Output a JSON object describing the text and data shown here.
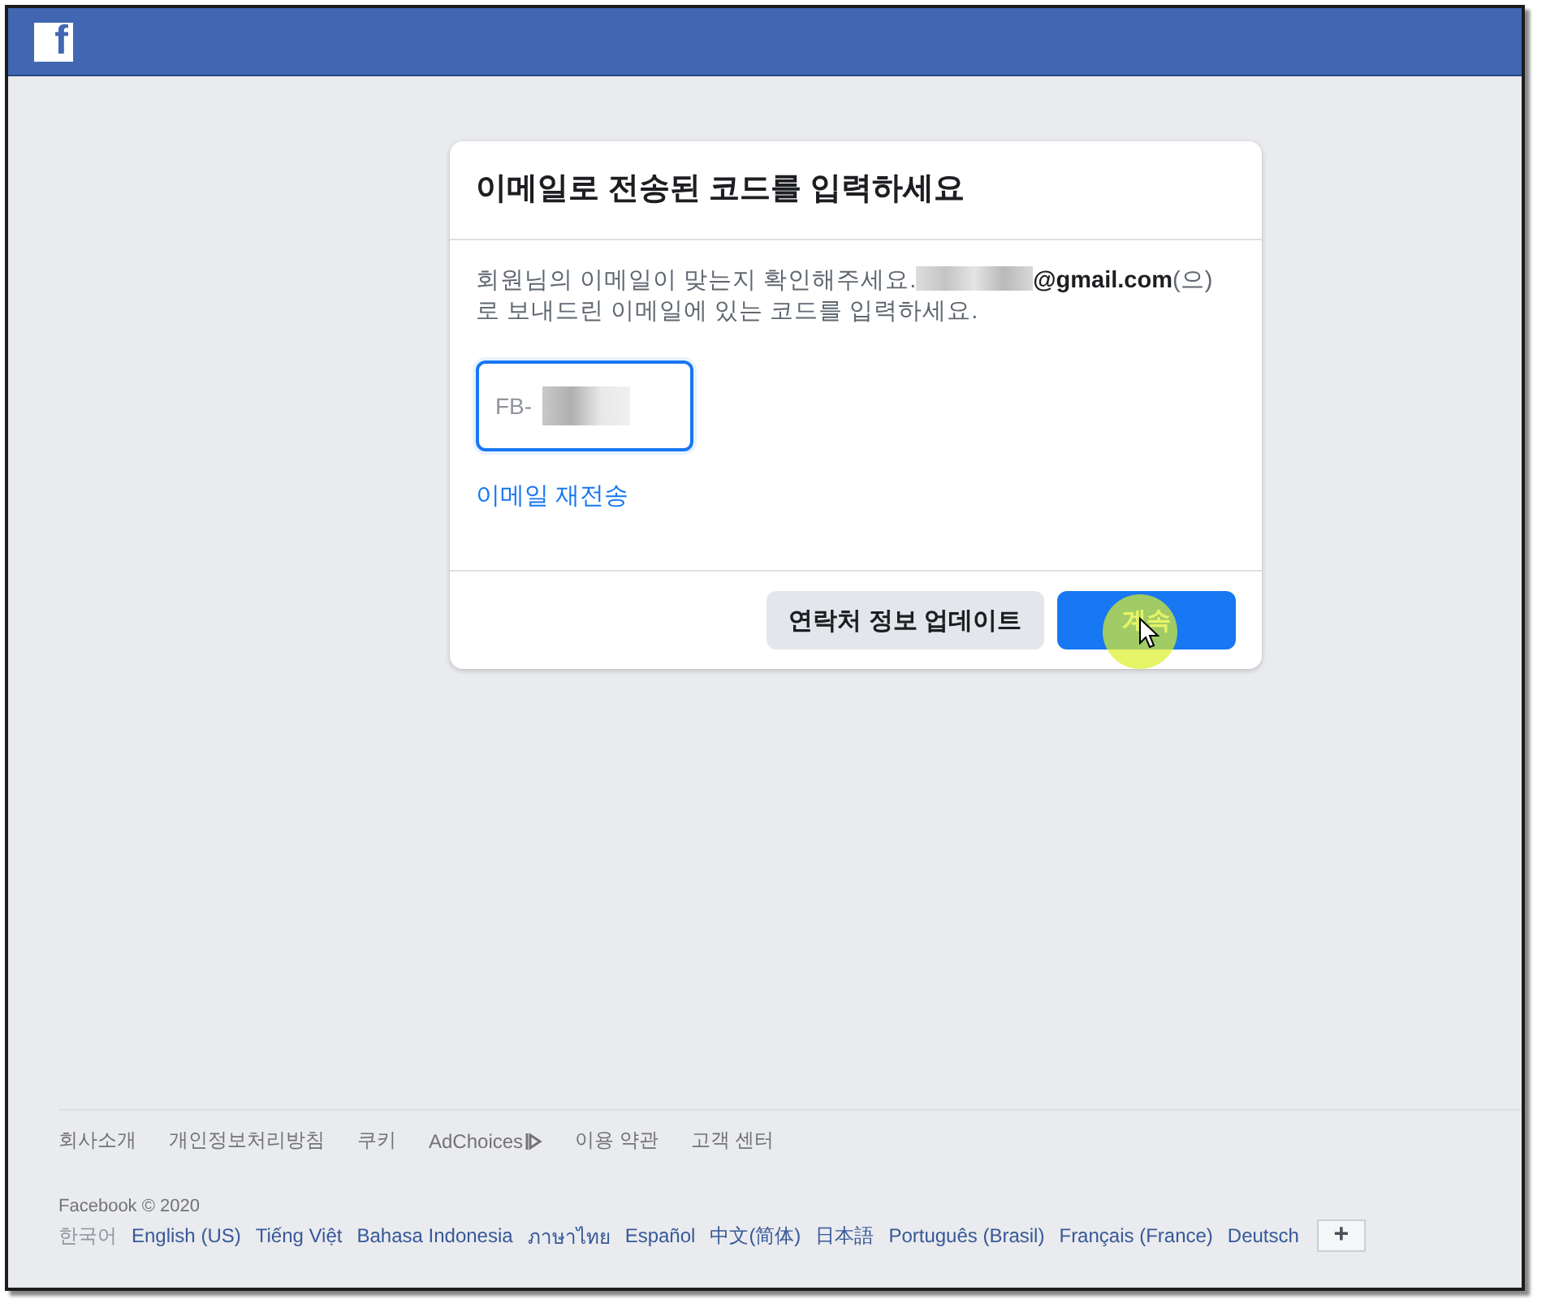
{
  "header": {
    "logo": "f"
  },
  "dialog": {
    "title": "이메일로 전송된 코드를 입력하세요",
    "message_before": "회원님의 이메일이 맞는지 확인해주세요.",
    "message_redacted": true,
    "message_after": "**@gmail.com**(으) 로 보내드린 이메일에 있는 코드를 입력하세요.",
    "code_field": {
      "value": "FB-",
      "redacted": true,
      "focused": true
    },
    "resend_link": "이메일 재전송",
    "buttons": [
      {
        "label": "연락처 정보 업데이트",
        "kind": "secondary"
      },
      {
        "label": "계속",
        "kind": "primary"
      }
    ]
  },
  "pointer": {
    "highlight": true
  },
  "footer": {
    "links": [
      "회사소개",
      "개인정보처리방침",
      "쿠키",
      "AdChoices",
      "이용 약관",
      "고객 센터"
    ],
    "copyright": "Facebook © 2020",
    "languages": [
      {
        "label": "한국어",
        "selected": true
      },
      {
        "label": "English (US)",
        "selected": false
      },
      {
        "label": "Tiếng Việt",
        "selected": false
      },
      {
        "label": "Bahasa Indonesia",
        "selected": false
      },
      {
        "label": "ภาษาไทย",
        "selected": false
      },
      {
        "label": "Español",
        "selected": false
      },
      {
        "label": "中文(简体)",
        "selected": false
      },
      {
        "label": "日本語",
        "selected": false
      },
      {
        "label": "Português (Brasil)",
        "selected": false
      },
      {
        "label": "Français (France)",
        "selected": false
      },
      {
        "label": "Deutsch",
        "selected": false
      }
    ],
    "more_button": "+"
  }
}
